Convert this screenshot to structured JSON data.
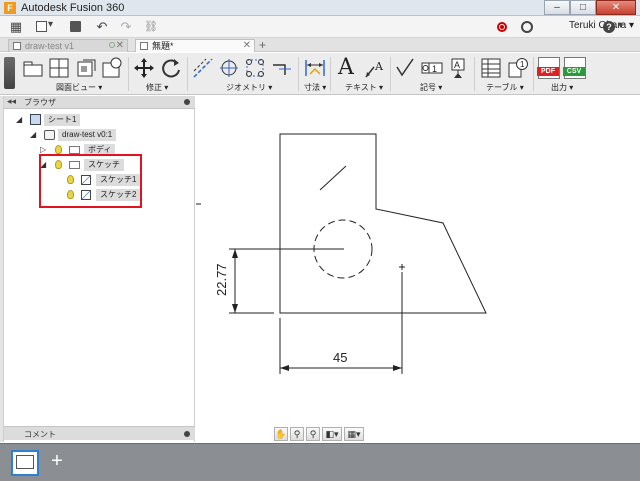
{
  "window": {
    "title": "Autodesk Fusion 360",
    "icon_letter": "F",
    "minimize": "–",
    "maximize": "□",
    "close": "✕"
  },
  "quick_access": {
    "grid": "▦",
    "file_menu": "▾",
    "save": "💾",
    "undo": "↶",
    "redo": "↷",
    "link": "🔗",
    "user": "Teruki Obara ▾",
    "help": "?",
    "help_arrow": "▾"
  },
  "tabs": [
    {
      "label": "draw-test v1",
      "state": "inactive",
      "close": "✕"
    },
    {
      "label": "無題*",
      "state": "active",
      "close": "✕"
    }
  ],
  "tab_add": "+",
  "toolbar": {
    "groups": [
      {
        "label": "図面ビュー ▾"
      },
      {
        "label": "修正 ▾"
      },
      {
        "label": "ジオメトリ ▾"
      },
      {
        "label": "寸法 ▾"
      },
      {
        "label": "テキスト ▾"
      },
      {
        "label": "記号 ▾"
      },
      {
        "label": "テーブル ▾"
      },
      {
        "label": "出力 ▾"
      }
    ],
    "text_tool": "A",
    "pdf": "PDF",
    "csv": "CSV",
    "balloon": "1"
  },
  "browser": {
    "collapse": "◂◂",
    "title": "ブラウザ",
    "items": [
      {
        "label": "シート1",
        "level": 0
      },
      {
        "label": "draw-test v0:1",
        "level": 1
      },
      {
        "label": "ボディ",
        "level": 2
      },
      {
        "label": "スケッチ",
        "level": 2
      },
      {
        "label": "スケッチ1",
        "level": 3
      },
      {
        "label": "スケッチ2",
        "level": 3
      }
    ],
    "tree_expanded": "◢",
    "tree_collapsed": "▷"
  },
  "comment": {
    "label": "コメント",
    "add": "+"
  },
  "drawing": {
    "dim_vertical": "22.77",
    "dim_horizontal": "45"
  },
  "nav": {
    "pan": "✋",
    "zoom": "⚲",
    "zoom_window": "⚲",
    "view": "◧▾",
    "display": "▦▾"
  },
  "sheets": {
    "add": "+"
  },
  "colors": {
    "highlight": "#e0141e",
    "accent": "#2f7fd1"
  }
}
